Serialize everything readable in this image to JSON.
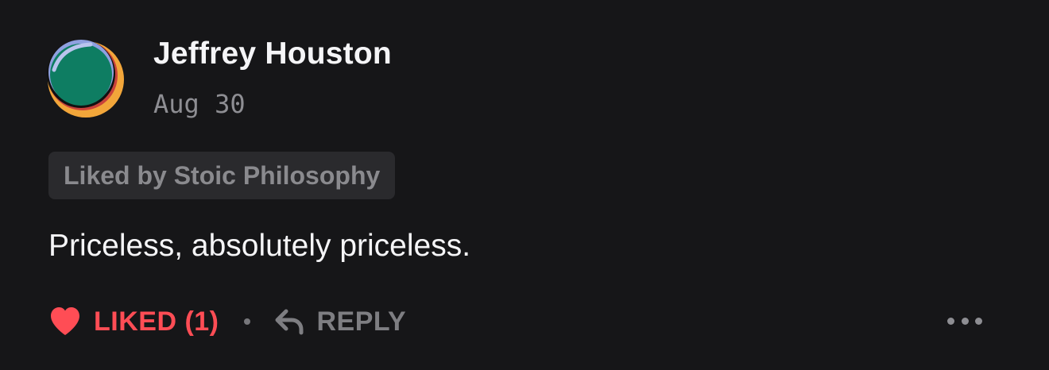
{
  "comment": {
    "author": "Jeffrey Houston",
    "timestamp": "Aug 30",
    "liked_by": "Liked by Stoic Philosophy",
    "body": "Priceless, absolutely priceless.",
    "avatar_icon": "abstract-circle-avatar"
  },
  "actions": {
    "like_label": "LIKED (1)",
    "like_icon": "heart-icon",
    "separator": "·",
    "reply_label": "REPLY",
    "reply_icon": "reply-arrow-icon",
    "more_icon": "more-horizontal-icon"
  },
  "colors": {
    "background": "#161618",
    "liked_accent": "#ff4d55",
    "muted_text": "#7e7e82",
    "primary_text": "#f5f5f7",
    "avatar_green": "#0e7d62",
    "avatar_orange": "#f2a63a",
    "avatar_blue": "#7a8fd6"
  }
}
